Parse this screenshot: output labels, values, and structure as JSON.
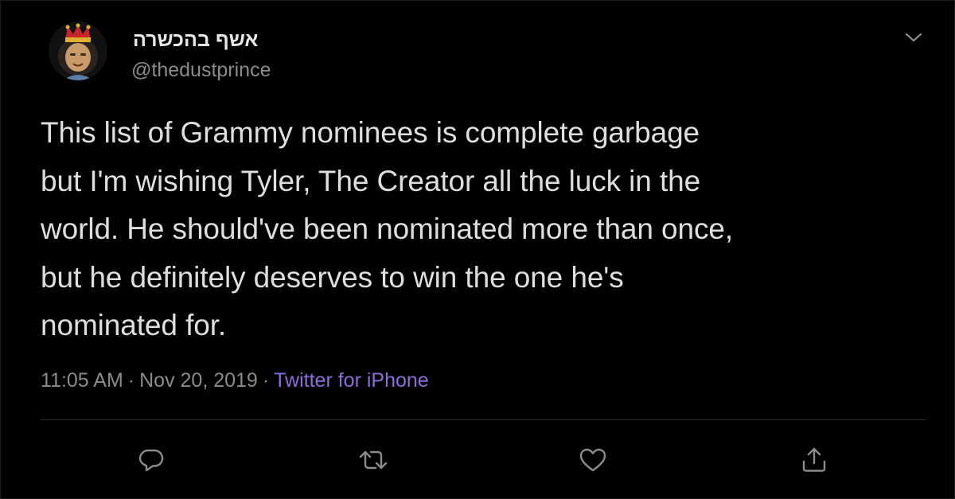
{
  "tweet": {
    "display_name": "אשף בהכשרה",
    "handle": "@thedustprince",
    "text": "This list of Grammy nominees is complete garbage\nbut I'm wishing Tyler, The Creator all the luck in the\nworld. He should've been nominated more than once,\nbut he definitely deserves to win the one he's\nnominated for.",
    "time": "11:05 AM",
    "date": "Nov 20, 2019",
    "separator": "·",
    "source": "Twitter for iPhone"
  },
  "icons": {
    "avatar": "crowned-avatar",
    "caret": "chevron-down-icon",
    "reply": "reply-icon",
    "retweet": "retweet-icon",
    "like": "heart-icon",
    "share": "share-icon"
  },
  "colors": {
    "background": "#000000",
    "text": "#dedede",
    "secondary": "#8b8b8b",
    "link": "#8d6bd8",
    "divider": "#2c2c2c"
  }
}
